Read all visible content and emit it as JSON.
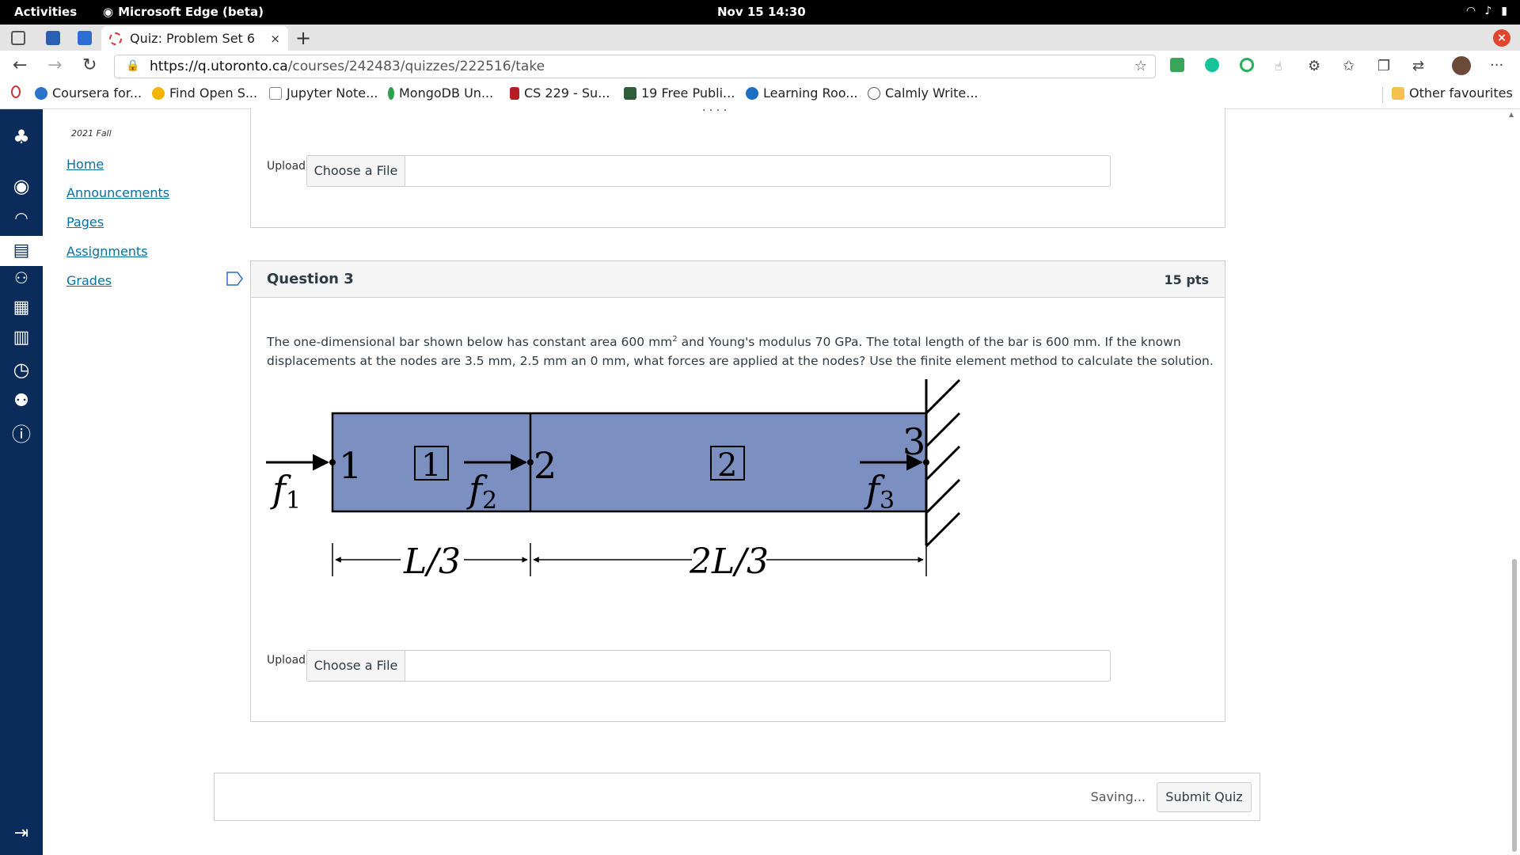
{
  "os_bar": {
    "activities": "Activities",
    "app_name": "Microsoft Edge (beta)",
    "clock": "Nov 15  14:30"
  },
  "browser": {
    "tab_title": "Quiz: Problem Set 6",
    "tab_close": "×",
    "new_tab": "+",
    "url_host": "https://q.utoronto.ca",
    "url_path": "/courses/242483/quizzes/222516/take",
    "bookmarks": [
      "Coursera for...",
      "Find Open S...",
      "Jupyter Note...",
      "MongoDB Un...",
      "CS 229 - Su...",
      "19 Free Publi...",
      "Learning Roo...",
      "Calmly Write..."
    ],
    "other_favourites": "Other favourites"
  },
  "course_nav": {
    "term": "2021 Fall",
    "links": [
      "Home",
      "Announcements",
      "Pages",
      "Assignments",
      "Grades"
    ]
  },
  "question_prev": {
    "upload_label": "Upload",
    "file_button": "Choose a File"
  },
  "question3": {
    "title": "Question 3",
    "points": "15 pts",
    "text_part1": "The one-dimensional bar shown below has constant area 600 mm",
    "text_sup": "2",
    "text_part2": " and Young's modulus 70 GPa. The total length of the bar is 600 mm. If the known displacements at the nodes are 3.5 mm, 2.5 mm an 0 mm, what forces are applied at the nodes? Use the finite element method to calculate the solution.",
    "upload_label": "Upload",
    "file_button": "Choose a File",
    "diagram": {
      "node_labels": [
        "1",
        "2",
        "3"
      ],
      "element_labels": [
        "1",
        "2"
      ],
      "force_labels": [
        "f",
        "f",
        "f"
      ],
      "force_subscripts": [
        "1",
        "2",
        "3"
      ],
      "dim_left": "L/3",
      "dim_right": "2L/3",
      "bar_color": "#7b8fc0"
    }
  },
  "footer": {
    "saving": "Saving...",
    "submit": "Submit Quiz"
  }
}
